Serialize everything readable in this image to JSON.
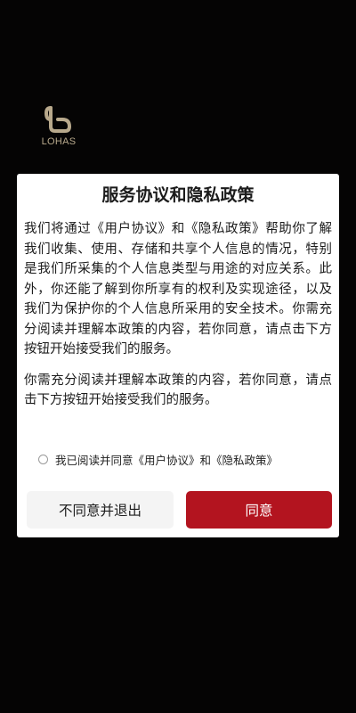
{
  "brand": {
    "name": "LOHAS",
    "color": "#b8a98c"
  },
  "dialog": {
    "title": "服务协议和隐私政策",
    "paragraphs": [
      "我们将通过《用户协议》和《隐私政策》帮助你了解我们收集、使用、存储和共享个人信息的情况，特别是我们所采集的个人信息类型与用途的对应关系。此外，你还能了解到你所享有的权利及实现途径，以及我们为保护你的个人信息所采用的安全技术。你需充分阅读并理解本政策的内容，若你同意，请点击下方按钮开始接受我们的服务。",
      "你需充分阅读并理解本政策的内容，若你同意，请点击下方按钮开始接受我们的服务。"
    ],
    "consent_label": "我已阅读并同意《用户协议》和《隐私政策》",
    "consent_checked": false,
    "decline_label": "不同意并退出",
    "agree_label": "同意"
  },
  "colors": {
    "background": "#050404",
    "accent": "#b3141f",
    "decline_bg": "#f4f4f4"
  }
}
